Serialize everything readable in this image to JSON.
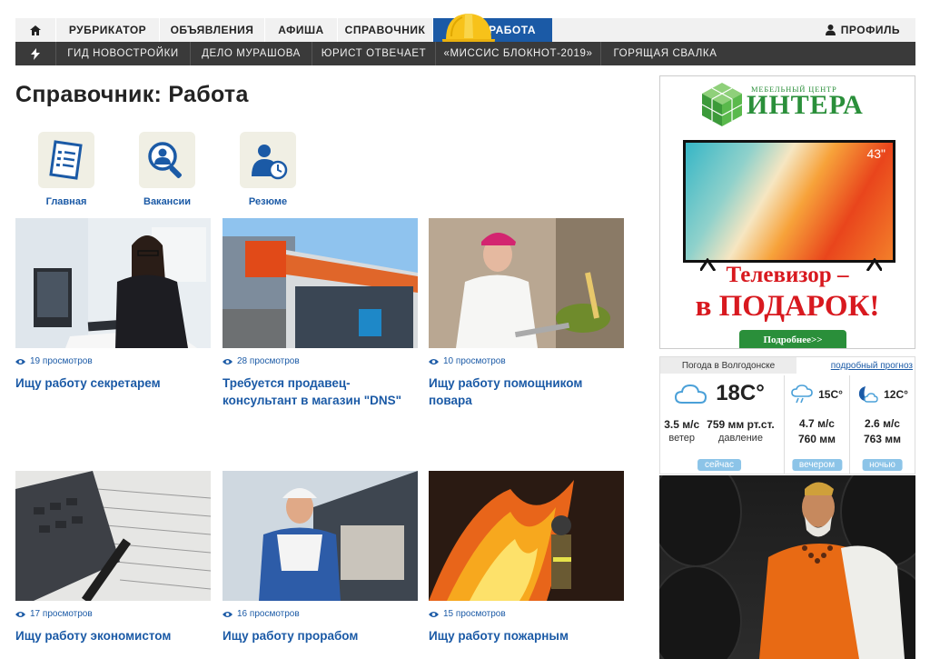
{
  "nav": {
    "home_icon": "home-icon",
    "items": [
      "РУБРИКАТОР",
      "ОБЪЯВЛЕНИЯ",
      "АФИША",
      "СПРАВОЧНИК",
      "РАБОТА"
    ],
    "profile": "ПРОФИЛЬ",
    "active": "РАБОТА",
    "accent": "#1b5aa6"
  },
  "subnav": {
    "icon": "bolt-icon",
    "items": [
      "ГИД НОВОСТРОЙКИ",
      "ДЕЛО МУРАШОВА",
      "ЮРИСТ ОТВЕЧАЕТ",
      "«МИССИС БЛОКНОТ-2019»",
      "ГОРЯЩАЯ СВАЛКА"
    ]
  },
  "page": {
    "title": "Справочник: Работа"
  },
  "categories": [
    {
      "label": "Главная",
      "icon": "document-list-icon"
    },
    {
      "label": "Вакансии",
      "icon": "search-people-icon"
    },
    {
      "label": "Резюме",
      "icon": "person-clock-icon"
    }
  ],
  "cards": [
    {
      "views": "19 просмотров",
      "title": "Ищу работу секретарем"
    },
    {
      "views": "28 просмотров",
      "title": "Требуется продавец-консультант в магазин \"DNS\""
    },
    {
      "views": "10 просмотров",
      "title": "Ищу работу помощником повара"
    },
    {
      "views": "17 просмотров",
      "title": "Ищу работу экономистом"
    },
    {
      "views": "16 просмотров",
      "title": "Ищу работу прорабом"
    },
    {
      "views": "15 просмотров",
      "title": "Ищу работу пожарным"
    }
  ],
  "ad": {
    "brand_top": "МЕБЕЛЬНЫЙ ЦЕНТР",
    "brand": "ИНТЕРА",
    "tv_size": "43\"",
    "promo_line1": "Телевизор –",
    "promo_line2": "в ПОДАРОК!",
    "more": "Подробнее>>"
  },
  "weather": {
    "tag": "Погода в Волгодонске",
    "detail_link": "подробный прогноз",
    "now": {
      "temp": "18C°",
      "wind": "3.5 м/с",
      "wind_label": "ветер",
      "pressure": "759 мм рт.ст.",
      "pressure_label": "давление",
      "label": "сейчас"
    },
    "evening": {
      "temp": "15C°",
      "wind": "4.7 м/с",
      "pressure": "760 мм",
      "label": "вечером"
    },
    "night": {
      "temp": "12C°",
      "wind": "2.6 м/с",
      "pressure": "763 мм",
      "label": "ночью"
    }
  }
}
